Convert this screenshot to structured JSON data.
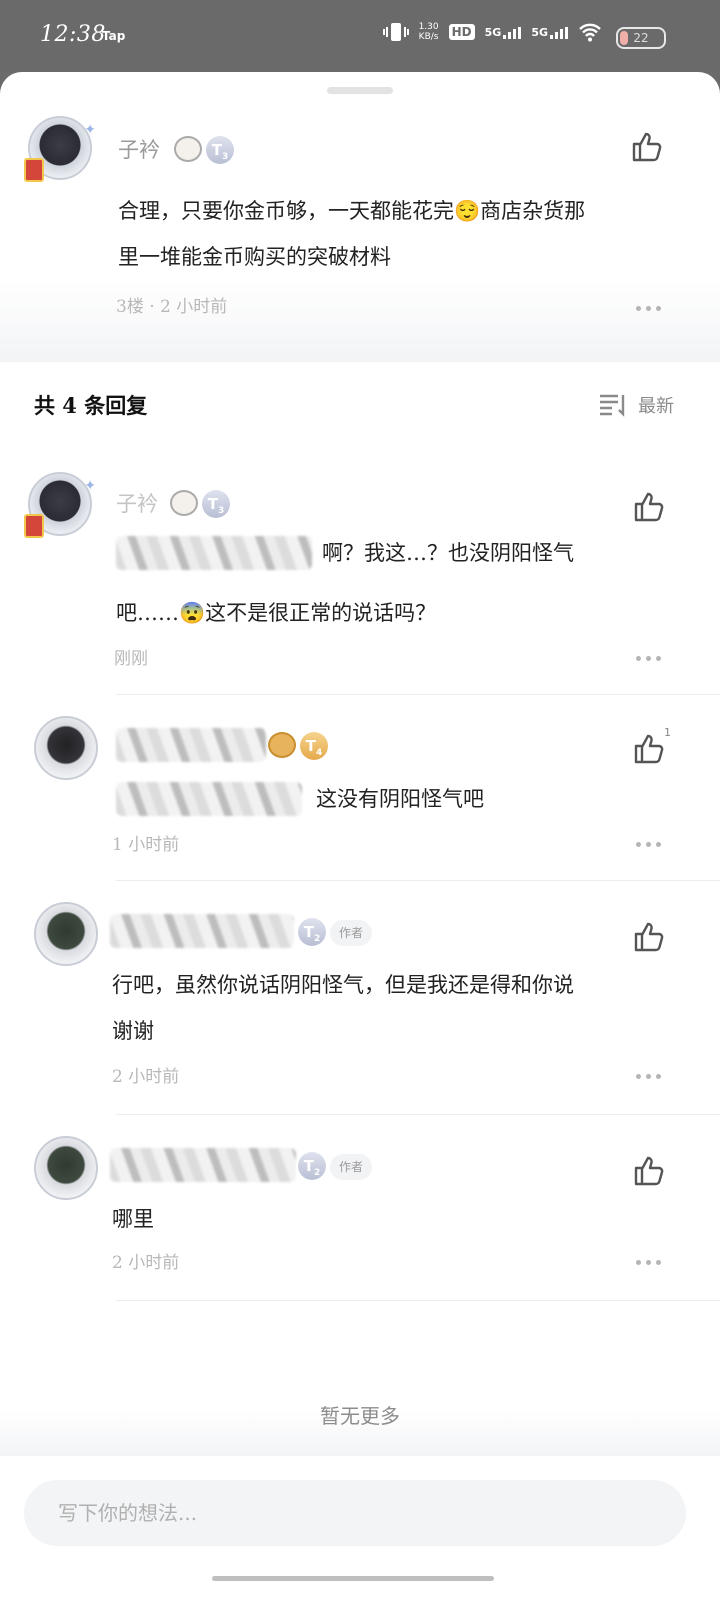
{
  "status_bar": {
    "time": "12:38",
    "app_label": "Tap",
    "net_speed": "1.30",
    "net_unit": "KB/s",
    "hd": "HD",
    "sim1": "5G",
    "sim2": "5G",
    "battery": "22"
  },
  "root_comment": {
    "username": "子衿",
    "badge": "T",
    "badge_level": "3",
    "text_line1": "合理，只要你金币够，一天都能花完😌商店杂货那",
    "text_line2": "里一堆能金币购买的突破材料",
    "meta": "3楼 · 2 小时前"
  },
  "replies_header": {
    "title": "共 4 条回复",
    "sort_label": "最新"
  },
  "replies": [
    {
      "username": "子衿",
      "badge": "T",
      "badge_level": "3",
      "text_line1": "啊？我这…？也没阴阳怪气",
      "text_line2": "吧……😨这不是很正常的说话吗？",
      "meta": "刚刚"
    },
    {
      "badge": "T",
      "badge_level": "4",
      "like_count": "1",
      "text_line1": "这没有阴阳怪气吧",
      "meta": "1 小时前"
    },
    {
      "badge": "T",
      "badge_level": "2",
      "author_tag": "作者",
      "text_line1": "行吧，虽然你说话阴阳怪气，但是我还是得和你说",
      "text_line2": "谢谢",
      "meta": "2 小时前"
    },
    {
      "badge": "T",
      "badge_level": "2",
      "author_tag": "作者",
      "text_line1": "哪里",
      "meta": "2 小时前"
    }
  ],
  "footer": {
    "no_more": "暂无更多",
    "compose_placeholder": "写下你的想法..."
  },
  "icons": {
    "like": "thumbs-up-icon",
    "more": "more-dots-icon",
    "sort": "sort-lines-icon"
  }
}
